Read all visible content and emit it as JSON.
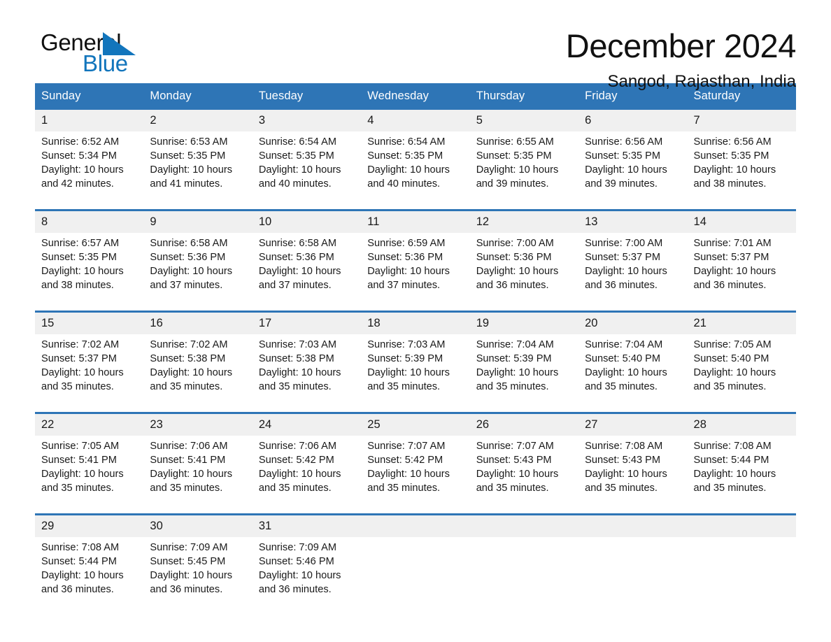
{
  "brand": {
    "name_top": "General",
    "name_bottom": "Blue",
    "triangle_color": "#1275bc",
    "text_color": "#101010"
  },
  "header": {
    "title": "December 2024",
    "location": "Sangod, Rajasthan, India"
  },
  "theme": {
    "header_bg": "#2e75b6",
    "header_text": "#ffffff",
    "daynum_bg": "#f0f0f0",
    "separator": "#2e75b6",
    "body_text": "#1a1a1a"
  },
  "weekday_headers": [
    "Sunday",
    "Monday",
    "Tuesday",
    "Wednesday",
    "Thursday",
    "Friday",
    "Saturday"
  ],
  "labels": {
    "sunrise_prefix": "Sunrise:",
    "sunset_prefix": "Sunset:",
    "daylight_prefix": "Daylight:"
  },
  "weeks": [
    [
      {
        "day": "1",
        "sunrise": "Sunrise: 6:52 AM",
        "sunset": "Sunset: 5:34 PM",
        "daylight_line1": "Daylight: 10 hours",
        "daylight_line2": "and 42 minutes."
      },
      {
        "day": "2",
        "sunrise": "Sunrise: 6:53 AM",
        "sunset": "Sunset: 5:35 PM",
        "daylight_line1": "Daylight: 10 hours",
        "daylight_line2": "and 41 minutes."
      },
      {
        "day": "3",
        "sunrise": "Sunrise: 6:54 AM",
        "sunset": "Sunset: 5:35 PM",
        "daylight_line1": "Daylight: 10 hours",
        "daylight_line2": "and 40 minutes."
      },
      {
        "day": "4",
        "sunrise": "Sunrise: 6:54 AM",
        "sunset": "Sunset: 5:35 PM",
        "daylight_line1": "Daylight: 10 hours",
        "daylight_line2": "and 40 minutes."
      },
      {
        "day": "5",
        "sunrise": "Sunrise: 6:55 AM",
        "sunset": "Sunset: 5:35 PM",
        "daylight_line1": "Daylight: 10 hours",
        "daylight_line2": "and 39 minutes."
      },
      {
        "day": "6",
        "sunrise": "Sunrise: 6:56 AM",
        "sunset": "Sunset: 5:35 PM",
        "daylight_line1": "Daylight: 10 hours",
        "daylight_line2": "and 39 minutes."
      },
      {
        "day": "7",
        "sunrise": "Sunrise: 6:56 AM",
        "sunset": "Sunset: 5:35 PM",
        "daylight_line1": "Daylight: 10 hours",
        "daylight_line2": "and 38 minutes."
      }
    ],
    [
      {
        "day": "8",
        "sunrise": "Sunrise: 6:57 AM",
        "sunset": "Sunset: 5:35 PM",
        "daylight_line1": "Daylight: 10 hours",
        "daylight_line2": "and 38 minutes."
      },
      {
        "day": "9",
        "sunrise": "Sunrise: 6:58 AM",
        "sunset": "Sunset: 5:36 PM",
        "daylight_line1": "Daylight: 10 hours",
        "daylight_line2": "and 37 minutes."
      },
      {
        "day": "10",
        "sunrise": "Sunrise: 6:58 AM",
        "sunset": "Sunset: 5:36 PM",
        "daylight_line1": "Daylight: 10 hours",
        "daylight_line2": "and 37 minutes."
      },
      {
        "day": "11",
        "sunrise": "Sunrise: 6:59 AM",
        "sunset": "Sunset: 5:36 PM",
        "daylight_line1": "Daylight: 10 hours",
        "daylight_line2": "and 37 minutes."
      },
      {
        "day": "12",
        "sunrise": "Sunrise: 7:00 AM",
        "sunset": "Sunset: 5:36 PM",
        "daylight_line1": "Daylight: 10 hours",
        "daylight_line2": "and 36 minutes."
      },
      {
        "day": "13",
        "sunrise": "Sunrise: 7:00 AM",
        "sunset": "Sunset: 5:37 PM",
        "daylight_line1": "Daylight: 10 hours",
        "daylight_line2": "and 36 minutes."
      },
      {
        "day": "14",
        "sunrise": "Sunrise: 7:01 AM",
        "sunset": "Sunset: 5:37 PM",
        "daylight_line1": "Daylight: 10 hours",
        "daylight_line2": "and 36 minutes."
      }
    ],
    [
      {
        "day": "15",
        "sunrise": "Sunrise: 7:02 AM",
        "sunset": "Sunset: 5:37 PM",
        "daylight_line1": "Daylight: 10 hours",
        "daylight_line2": "and 35 minutes."
      },
      {
        "day": "16",
        "sunrise": "Sunrise: 7:02 AM",
        "sunset": "Sunset: 5:38 PM",
        "daylight_line1": "Daylight: 10 hours",
        "daylight_line2": "and 35 minutes."
      },
      {
        "day": "17",
        "sunrise": "Sunrise: 7:03 AM",
        "sunset": "Sunset: 5:38 PM",
        "daylight_line1": "Daylight: 10 hours",
        "daylight_line2": "and 35 minutes."
      },
      {
        "day": "18",
        "sunrise": "Sunrise: 7:03 AM",
        "sunset": "Sunset: 5:39 PM",
        "daylight_line1": "Daylight: 10 hours",
        "daylight_line2": "and 35 minutes."
      },
      {
        "day": "19",
        "sunrise": "Sunrise: 7:04 AM",
        "sunset": "Sunset: 5:39 PM",
        "daylight_line1": "Daylight: 10 hours",
        "daylight_line2": "and 35 minutes."
      },
      {
        "day": "20",
        "sunrise": "Sunrise: 7:04 AM",
        "sunset": "Sunset: 5:40 PM",
        "daylight_line1": "Daylight: 10 hours",
        "daylight_line2": "and 35 minutes."
      },
      {
        "day": "21",
        "sunrise": "Sunrise: 7:05 AM",
        "sunset": "Sunset: 5:40 PM",
        "daylight_line1": "Daylight: 10 hours",
        "daylight_line2": "and 35 minutes."
      }
    ],
    [
      {
        "day": "22",
        "sunrise": "Sunrise: 7:05 AM",
        "sunset": "Sunset: 5:41 PM",
        "daylight_line1": "Daylight: 10 hours",
        "daylight_line2": "and 35 minutes."
      },
      {
        "day": "23",
        "sunrise": "Sunrise: 7:06 AM",
        "sunset": "Sunset: 5:41 PM",
        "daylight_line1": "Daylight: 10 hours",
        "daylight_line2": "and 35 minutes."
      },
      {
        "day": "24",
        "sunrise": "Sunrise: 7:06 AM",
        "sunset": "Sunset: 5:42 PM",
        "daylight_line1": "Daylight: 10 hours",
        "daylight_line2": "and 35 minutes."
      },
      {
        "day": "25",
        "sunrise": "Sunrise: 7:07 AM",
        "sunset": "Sunset: 5:42 PM",
        "daylight_line1": "Daylight: 10 hours",
        "daylight_line2": "and 35 minutes."
      },
      {
        "day": "26",
        "sunrise": "Sunrise: 7:07 AM",
        "sunset": "Sunset: 5:43 PM",
        "daylight_line1": "Daylight: 10 hours",
        "daylight_line2": "and 35 minutes."
      },
      {
        "day": "27",
        "sunrise": "Sunrise: 7:08 AM",
        "sunset": "Sunset: 5:43 PM",
        "daylight_line1": "Daylight: 10 hours",
        "daylight_line2": "and 35 minutes."
      },
      {
        "day": "28",
        "sunrise": "Sunrise: 7:08 AM",
        "sunset": "Sunset: 5:44 PM",
        "daylight_line1": "Daylight: 10 hours",
        "daylight_line2": "and 35 minutes."
      }
    ],
    [
      {
        "day": "29",
        "sunrise": "Sunrise: 7:08 AM",
        "sunset": "Sunset: 5:44 PM",
        "daylight_line1": "Daylight: 10 hours",
        "daylight_line2": "and 36 minutes."
      },
      {
        "day": "30",
        "sunrise": "Sunrise: 7:09 AM",
        "sunset": "Sunset: 5:45 PM",
        "daylight_line1": "Daylight: 10 hours",
        "daylight_line2": "and 36 minutes."
      },
      {
        "day": "31",
        "sunrise": "Sunrise: 7:09 AM",
        "sunset": "Sunset: 5:46 PM",
        "daylight_line1": "Daylight: 10 hours",
        "daylight_line2": "and 36 minutes."
      },
      {
        "day": "",
        "sunrise": "",
        "sunset": "",
        "daylight_line1": "",
        "daylight_line2": ""
      },
      {
        "day": "",
        "sunrise": "",
        "sunset": "",
        "daylight_line1": "",
        "daylight_line2": ""
      },
      {
        "day": "",
        "sunrise": "",
        "sunset": "",
        "daylight_line1": "",
        "daylight_line2": ""
      },
      {
        "day": "",
        "sunrise": "",
        "sunset": "",
        "daylight_line1": "",
        "daylight_line2": ""
      }
    ]
  ]
}
